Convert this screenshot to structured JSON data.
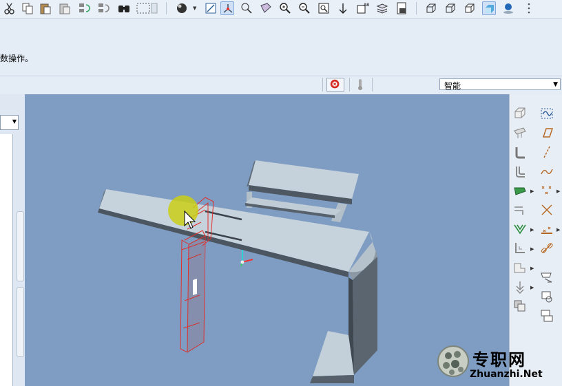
{
  "message": {
    "text": "数操作。"
  },
  "status": {
    "stop_icon": "stop-regen-icon",
    "disabled_icon": "thermometer-icon",
    "filter": {
      "value": "智能",
      "arrow": "▼"
    }
  },
  "left_panel": {
    "dropdown_arrow": "▼"
  },
  "watermark": {
    "brand_cn": "专职网",
    "brand_url": "Zhuanzhi.Net"
  },
  "colors": {
    "viewport_bg": "#7f9dc3",
    "model_top": "#c5d1da",
    "model_side": "#4f5964",
    "preview_outline": "#e0302a",
    "cursor_highlight": "#c9cf16"
  },
  "toolbar_icons": [
    "cut-icon",
    "copy-icon",
    "paste-icon",
    "paste-special-icon",
    "regenerate-icon",
    "regen-manager-icon",
    "find-icon",
    "select-box-icon",
    "shading-icon",
    "repaint-icon",
    "spin-center-icon",
    "orient-icon",
    "view-manager-icon",
    "zoom-in-icon",
    "zoom-out-icon",
    "refit-icon",
    "datum-display-icon",
    "annotation-display-icon",
    "layers-icon",
    "screenshot-icon",
    "wireframe-icon",
    "hidden-line-icon",
    "no-hidden-icon",
    "shaded-icon",
    "appearance-icon",
    "more-icon"
  ],
  "right_panel_icons": [
    "extrude-wall-icon",
    "sketch-curve-icon",
    "flat-wall-icon",
    "datum-plane-icon",
    "flange-wall-icon",
    "datum-axis-icon",
    "twist-wall-icon",
    "datum-curve-icon",
    "extend-wall-icon",
    "datum-point-icon",
    "bend-icon",
    "coordinate-system-icon",
    "unbend-icon",
    "datum-analysis-icon",
    "bend-back-icon",
    "chain-icon",
    "corner-relief-icon",
    "form-icon",
    "rip-icon",
    "flatten-icon",
    "merge-icon",
    "convert-icon"
  ]
}
